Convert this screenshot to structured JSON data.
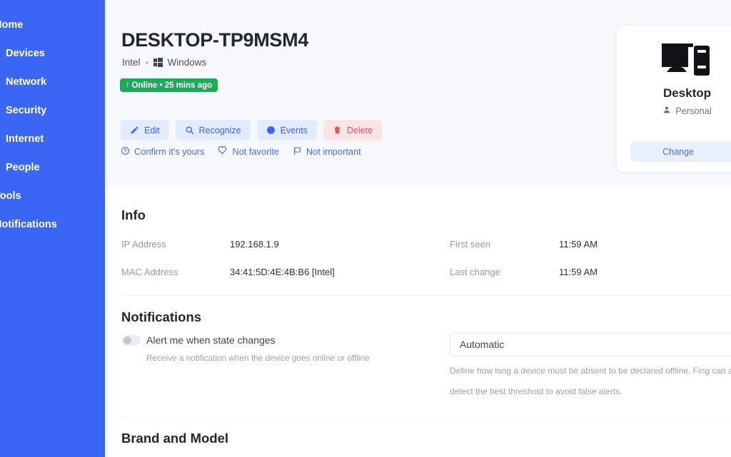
{
  "sidebar": {
    "background_color": "#3b65f5",
    "items": [
      {
        "label": "Home",
        "level": "top",
        "name": "sidebar-item-home"
      },
      {
        "label": "Devices",
        "level": "sub",
        "name": "sidebar-item-devices"
      },
      {
        "label": "Network",
        "level": "sub",
        "name": "sidebar-item-network"
      },
      {
        "label": "Security",
        "level": "sub",
        "name": "sidebar-item-security"
      },
      {
        "label": "Internet",
        "level": "sub",
        "name": "sidebar-item-internet"
      },
      {
        "label": "People",
        "level": "sub",
        "name": "sidebar-item-people"
      },
      {
        "label": "Tools",
        "level": "top",
        "name": "sidebar-item-tools"
      },
      {
        "label": "Notifications",
        "level": "top",
        "name": "sidebar-item-notifications"
      }
    ]
  },
  "header": {
    "device_name": "DESKTOP-TP9MSM4",
    "vendor": "Intel",
    "os": "Windows",
    "status": {
      "text": "Online • 25 mins ago",
      "arrow": "↑",
      "color": "#22a85a"
    },
    "buttons": [
      {
        "label": "Edit",
        "icon": "pencil-icon",
        "name": "edit-button"
      },
      {
        "label": "Recognize",
        "icon": "search-icon",
        "name": "recognize-button"
      },
      {
        "label": "Events",
        "icon": "clock-icon",
        "name": "events-button"
      },
      {
        "label": "Delete",
        "icon": "trash-icon",
        "name": "delete-button",
        "variant": "danger"
      }
    ],
    "sub_links": [
      {
        "label": "Confirm it's yours",
        "icon": "question-circle-icon",
        "name": "confirm-its-yours-link"
      },
      {
        "label": "Not favorite",
        "icon": "heart-icon",
        "name": "not-favorite-link"
      },
      {
        "label": "Not important",
        "icon": "flag-icon",
        "name": "not-important-link"
      }
    ]
  },
  "device_card": {
    "icon": "desktop-computer-icon",
    "type": "Desktop",
    "owner": "Personal",
    "owner_icon": "person-icon",
    "change_label": "Change"
  },
  "info": {
    "title": "Info",
    "rows_left": [
      {
        "label": "IP Address",
        "value": "192.168.1.9"
      },
      {
        "label": "MAC Address",
        "value": "34:41:5D:4E:4B:B6 [Intel]"
      }
    ],
    "rows_right": [
      {
        "label": "First seen",
        "value": "11:59 AM"
      },
      {
        "label": "Last change",
        "value": "11:59 AM"
      }
    ]
  },
  "notifications": {
    "title": "Notifications",
    "toggle": {
      "label": "Alert me when state changes",
      "hint": "Receive a notification when the device goes online or offline",
      "state": "off"
    },
    "offline_threshold": {
      "selected": "Automatic",
      "hint_line1": "Define how long a device must be absent to be declared offline. Fing can automatically",
      "hint_line2": "detect the best threshold to avoid false alerts."
    }
  },
  "brand_and_model": {
    "title": "Brand and Model"
  }
}
